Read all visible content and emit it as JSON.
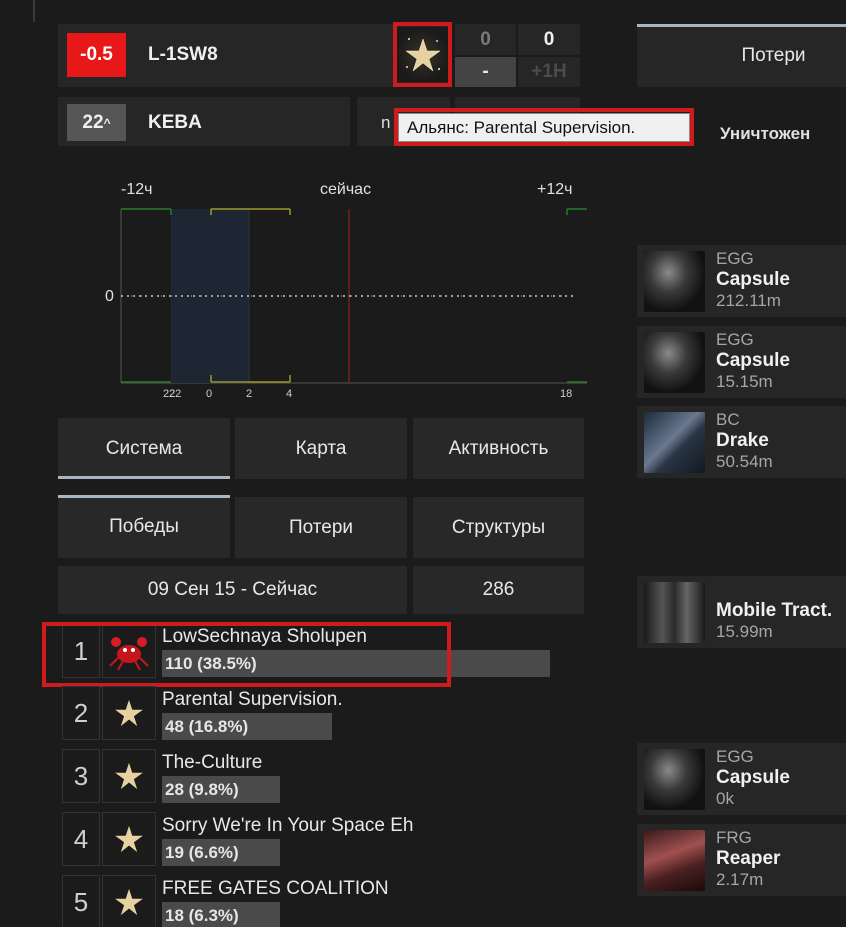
{
  "system": {
    "security": "-0.5",
    "name": "L-1SW8",
    "counter_top_left": "0",
    "counter_top_right": "0",
    "counter_bottom_left": "-",
    "counter_bottom_right": "+1H",
    "security_color": "#e81818"
  },
  "region_row": {
    "rank": "22",
    "rank_suffix": "^",
    "region": "KEBA",
    "partial_text": "n"
  },
  "tooltip": {
    "text": "Альянс: Parental Supervision."
  },
  "right_panel": {
    "losses_label": "Потери",
    "destroyed_label": "Уничтожен"
  },
  "timeline": {
    "label_left": "-12ч",
    "label_center": "сейчас",
    "label_right": "+12ч",
    "y_zero": "0",
    "ticks": [
      "22",
      "22",
      "0",
      "2",
      "4",
      "18"
    ]
  },
  "tabs": [
    {
      "label": "Система"
    },
    {
      "label": "Карта"
    },
    {
      "label": "Активность"
    }
  ],
  "subtabs": [
    {
      "label": "Победы"
    },
    {
      "label": "Потери"
    },
    {
      "label": "Структуры"
    }
  ],
  "period": {
    "range": "09 Сен 15 - Сейчас",
    "total": "286"
  },
  "leaderboard": [
    {
      "rank": "1",
      "name": "LowSechnaya Sholupen",
      "value": "110 (38.5%)",
      "share": 0.385
    },
    {
      "rank": "2",
      "name": "Parental Supervision.",
      "value": "48 (16.8%)",
      "share": 0.168
    },
    {
      "rank": "3",
      "name": "The-Culture",
      "value": "28 (9.8%)",
      "share": 0.098
    },
    {
      "rank": "4",
      "name": "Sorry We're In Your Space Eh",
      "value": "19 (6.6%)",
      "share": 0.066
    },
    {
      "rank": "5",
      "name": "FREE GATES COALITION",
      "value": "18 (6.3%)",
      "share": 0.063
    }
  ],
  "kills": [
    {
      "class": "EGG",
      "name": "Capsule",
      "value": "212.11m",
      "icon": "capsule-icon"
    },
    {
      "class": "EGG",
      "name": "Capsule",
      "value": "15.15m",
      "icon": "capsule-icon"
    },
    {
      "class": "BC",
      "name": "Drake",
      "value": "50.54m",
      "icon": "drake-icon"
    },
    {
      "class": "",
      "name": "Mobile Tract.",
      "value": "15.99m",
      "icon": "mobile-tractor-icon"
    },
    {
      "class": "EGG",
      "name": "Capsule",
      "value": "0k",
      "icon": "capsule-icon"
    },
    {
      "class": "FRG",
      "name": "Reaper",
      "value": "2.17m",
      "icon": "reaper-icon"
    }
  ]
}
